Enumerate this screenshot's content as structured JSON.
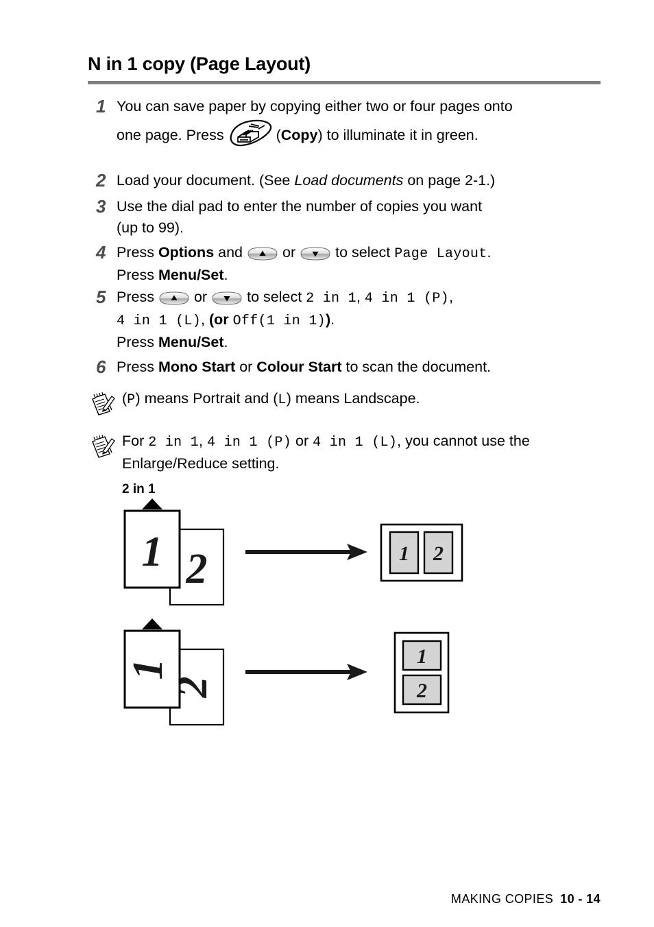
{
  "document": {
    "heading": "N in 1 copy (Page Layout)",
    "footer": {
      "section": "MAKING COPIES",
      "page_number": "10 - 14"
    },
    "colors": {
      "rule": "#7f7f7f",
      "step_number": "#4d4d4d",
      "page_fill": "#d4d4d4",
      "ink": "#000000",
      "paper": "#ffffff"
    }
  },
  "steps": [
    {
      "number": "1",
      "line1_a": "You can save paper by copying either two or four pages onto",
      "line2_a": "one page. Press",
      "icon": "copy-key-icon",
      "line2_b_open": "(",
      "line2_b_bold": "Copy",
      "line2_c": ") to illuminate it in green."
    },
    {
      "number": "2",
      "text_a": "Load your document. (See ",
      "text_italic": "Load documents",
      "text_b": " on page 2-1.)"
    },
    {
      "number": "3",
      "line1": "Use the dial pad to enter the number of copies you want",
      "line2": "(up to 99)."
    },
    {
      "number": "4",
      "l1_a": "Press ",
      "l1_bold1": "Options",
      "l1_b": " and",
      "icon_up": "arrow-up-key-icon",
      "l1_c": "or",
      "icon_down": "arrow-down-key-icon",
      "l1_d": "to select ",
      "l1_mono": "Page Layout",
      "l1_e": ".",
      "l2_a": "Press ",
      "l2_bold": "Menu/Set",
      "l2_b": "."
    },
    {
      "number": "5",
      "l1_a": "Press",
      "icon_up": "arrow-up-key-icon",
      "l1_b": "or",
      "icon_down": "arrow-down-key-icon",
      "l1_c": "to select ",
      "l1_mono1": "2 in 1",
      "l1_sep1": ", ",
      "l1_mono2": "4 in 1 (P)",
      "l1_sep2": ",",
      "l2_mono1": "4 in 1 (L)",
      "l2_sep1": ", ",
      "l2_bold1": "(or ",
      "l2_mono2": "Off(1 in 1)",
      "l2_bold2": ")",
      "l2_end": ".",
      "l3_a": "Press ",
      "l3_bold": "Menu/Set",
      "l3_b": "."
    },
    {
      "number": "6",
      "t_a": "Press ",
      "t_bold1": "Mono Start",
      "t_b": " or ",
      "t_bold2": "Colour Start",
      "t_c": " to scan the document."
    }
  ],
  "notes": [
    {
      "icon": "note-pencil-icon",
      "a_mono": "P",
      "a_text": ") means Portrait and (",
      "b_mono": "L",
      "b_text": ") means Landscape.",
      "open_paren": "("
    },
    {
      "icon": "note-pencil-icon",
      "l1_a": "For ",
      "l1_mono1": "2 in 1",
      "l1_sep1": ", ",
      "l1_mono2": "4 in 1 (P)",
      "l1_b": " or ",
      "l1_mono3": "4 in 1 (L)",
      "l1_c": ", you cannot use the",
      "l2": "Enlarge/Reduce setting."
    }
  ],
  "diagram": {
    "label": "2 in 1",
    "rows": [
      {
        "name": "portrait-row",
        "orientation": "portrait",
        "source_pages": [
          "1",
          "2"
        ],
        "result_pages": [
          "1",
          "2"
        ],
        "result_arrangement": "side-by-side",
        "marker": "up-triangle"
      },
      {
        "name": "landscape-row",
        "orientation": "landscape",
        "source_pages": [
          "1",
          "2"
        ],
        "result_pages": [
          "1",
          "2"
        ],
        "result_arrangement": "stacked",
        "marker": "up-triangle"
      }
    ]
  }
}
